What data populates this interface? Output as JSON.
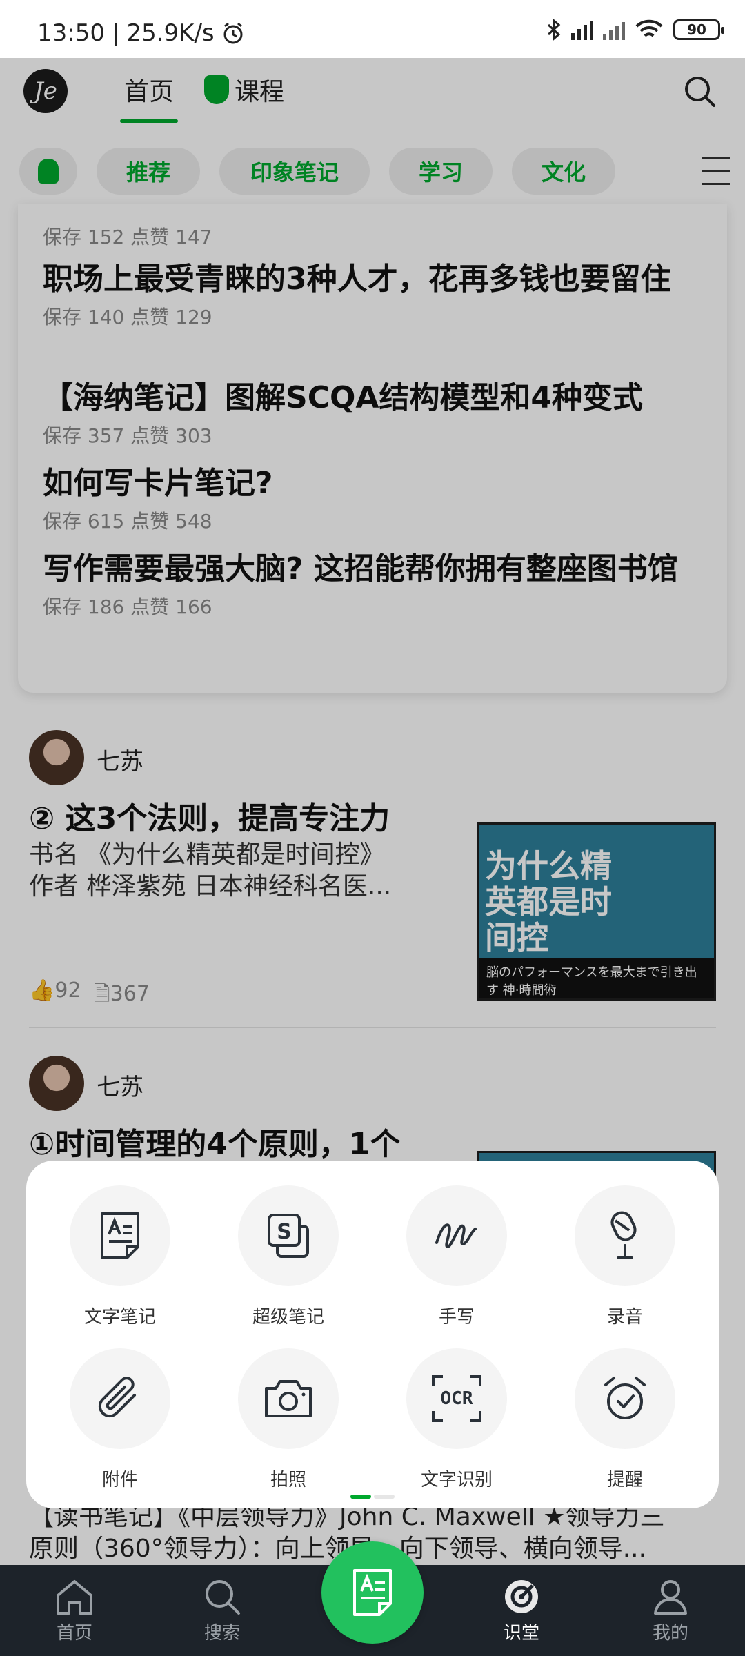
{
  "status_bar": {
    "time": "13:50",
    "speed": "25.9K/s",
    "battery": "90"
  },
  "header": {
    "tabs": [
      {
        "label": "首页"
      },
      {
        "label": "课程"
      }
    ]
  },
  "chips": [
    {
      "label": "推荐"
    },
    {
      "label": "印象笔记"
    },
    {
      "label": "学习"
    },
    {
      "label": "文化"
    }
  ],
  "card": {
    "partial_meta": "保存 152   点赞 147",
    "items": [
      {
        "title": "职场上最受青睐的3种人才，花再多钱也要留住",
        "meta": "保存 140   点赞 129"
      },
      {
        "title": "【海纳笔记】图解SCQA结构模型和4种变式",
        "meta": "保存 357   点赞 303"
      },
      {
        "title": "如何写卡片笔记?",
        "meta": "保存 615   点赞 548"
      },
      {
        "title": "写作需要最强大脑? 这招能帮你拥有整座图书馆",
        "meta": "保存 186   点赞 166"
      }
    ]
  },
  "posts": [
    {
      "author": "七苏",
      "title": "② 这3个法则，提高专注力",
      "body_line1": "书名 《为什么精英都是时间控》",
      "body_line2": "作者 桦泽紫苑 日本神经科名医...",
      "likes": "92",
      "saves": "367",
      "book_title": "为什么精英都是时间控",
      "book_strip": "脳のパフォーマンスを最大まで引き出す 神·時間術"
    },
    {
      "author": "七苏",
      "title": "①时间管理的4个原则，1个"
    }
  ],
  "sheet": {
    "actions": [
      {
        "label": "文字笔记",
        "icon": "text-note-icon"
      },
      {
        "label": "超级笔记",
        "icon": "super-note-icon"
      },
      {
        "label": "手写",
        "icon": "handwriting-icon"
      },
      {
        "label": "录音",
        "icon": "microphone-icon"
      },
      {
        "label": "附件",
        "icon": "paperclip-icon"
      },
      {
        "label": "拍照",
        "icon": "camera-icon"
      },
      {
        "label": "文字识别",
        "icon": "ocr-icon",
        "icon_text": "OCR"
      },
      {
        "label": "提醒",
        "icon": "alarm-icon"
      }
    ]
  },
  "bottom_text": {
    "line1": "【读书笔记】《中层领导力》John C. Maxwell ★领导力三",
    "line2": "原则（360°领导力）：向上领导、向下领导、横向领导..."
  },
  "bottom_nav": {
    "items": [
      {
        "label": "首页"
      },
      {
        "label": "搜索"
      },
      {
        "label": "识堂"
      },
      {
        "label": "我的"
      }
    ]
  },
  "colors": {
    "accent": "#00a82d",
    "fab": "#22c15e",
    "nav_bg": "#1d232a"
  }
}
